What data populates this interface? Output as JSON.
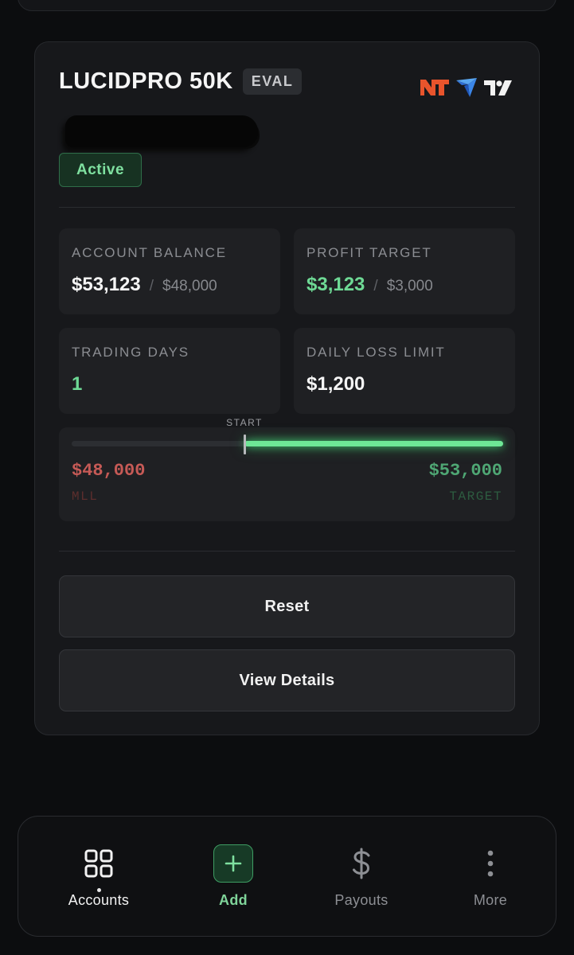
{
  "account": {
    "title": "LUCIDPRO 50K",
    "type_badge": "EVAL",
    "status": "Active",
    "platform_icons": [
      "ninjatrader-icon",
      "tradovate-icon",
      "tradingview-icon"
    ]
  },
  "stats": {
    "balance": {
      "label": "ACCOUNT BALANCE",
      "value": "$53,123",
      "separator": "/",
      "sub": "$48,000"
    },
    "profit_target": {
      "label": "PROFIT TARGET",
      "value": "$3,123",
      "separator": "/",
      "sub": "$3,000"
    },
    "trading_days": {
      "label": "TRADING DAYS",
      "value": "1"
    },
    "daily_loss": {
      "label": "DAILY LOSS LIMIT",
      "value": "$1,200"
    }
  },
  "progress": {
    "start_label": "START",
    "mll_value": "$48,000",
    "mll_label": "MLL",
    "target_value": "$53,000",
    "target_label": "TARGET",
    "start_fraction": 0.4,
    "current_fraction": 1.0
  },
  "buttons": {
    "reset": "Reset",
    "view_details": "View Details"
  },
  "nav": {
    "items": [
      {
        "label": "Accounts",
        "icon": "grid-icon",
        "active": true
      },
      {
        "label": "Add",
        "icon": "plus-icon",
        "active": false
      },
      {
        "label": "Payouts",
        "icon": "dollar-icon",
        "active": false
      },
      {
        "label": "More",
        "icon": "more-vertical-icon",
        "active": false
      }
    ]
  },
  "colors": {
    "accent_green": "#6ed995",
    "loss_red": "#c65a56",
    "background": "#0c0d0f",
    "card": "#17181b"
  }
}
